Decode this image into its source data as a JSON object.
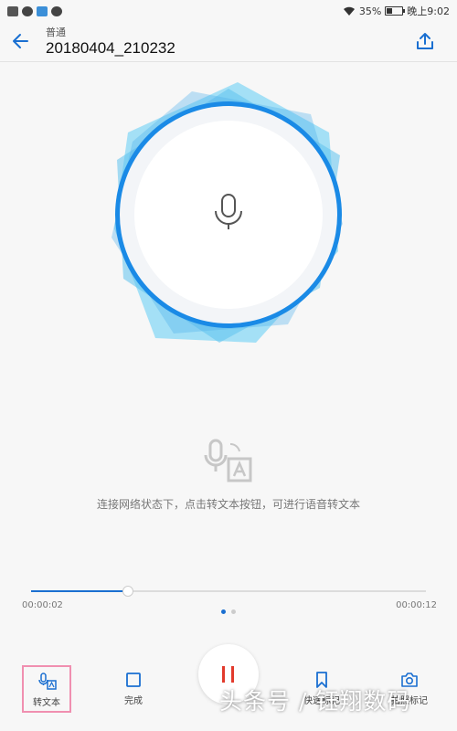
{
  "status_bar": {
    "battery_percent": "35%",
    "time": "晚上9:02"
  },
  "header": {
    "category": "普通",
    "title": "20180404_210232"
  },
  "hint": "连接网络状态下，点击转文本按钮，可进行语音转文本",
  "playback": {
    "current_time": "00:00:02",
    "total_time": "00:00:12",
    "progress": 0.245
  },
  "pager": {
    "count": 2,
    "active": 0
  },
  "toolbar": {
    "transcribe_label": "转文本",
    "finish_label": "完成",
    "mark_label": "快速标记",
    "photo_label": "拍照标记"
  },
  "watermark": "头条号 / 钰翔数码",
  "colors": {
    "accent": "#1a6fd1",
    "pause": "#e23a2c",
    "highlight_border": "#f08fb0"
  },
  "icons": [
    "back-arrow-icon",
    "share-icon",
    "microphone-icon",
    "speech-to-text-icon",
    "pause-icon",
    "stop-icon",
    "bookmark-icon",
    "camera-icon"
  ]
}
